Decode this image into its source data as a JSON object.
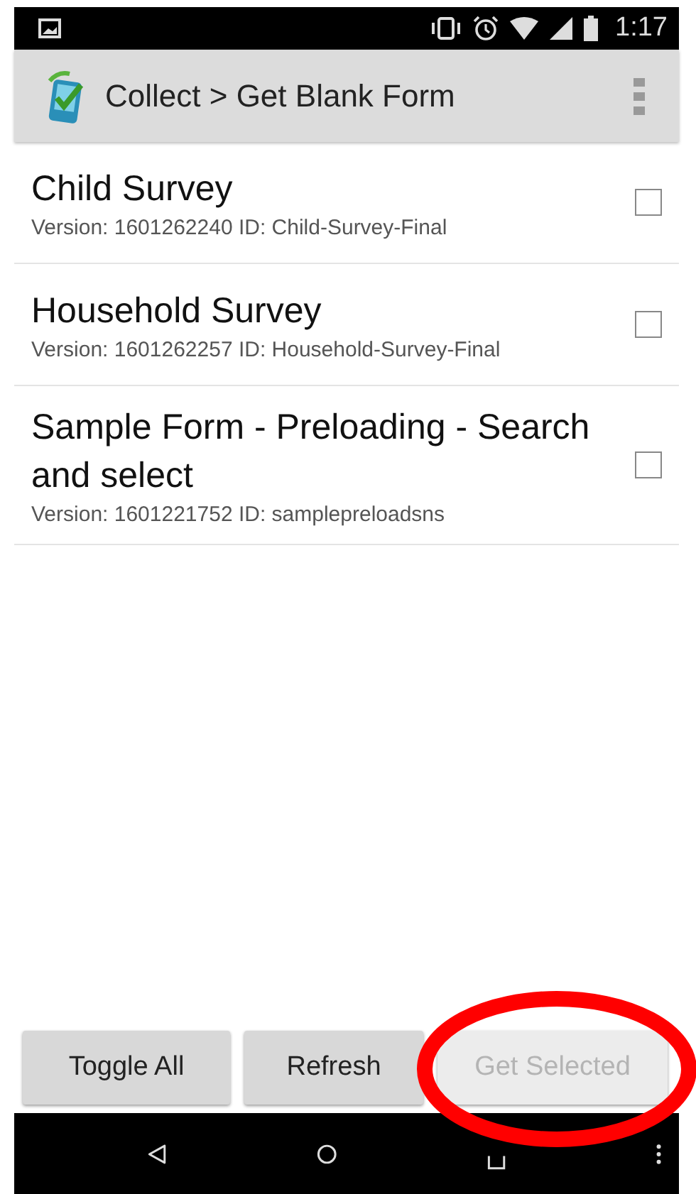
{
  "status_bar": {
    "time": "1:17"
  },
  "app_bar": {
    "title": "Collect > Get Blank Form"
  },
  "forms": [
    {
      "title": "Child Survey",
      "subtitle": "Version: 1601262240 ID: Child-Survey-Final",
      "checked": false
    },
    {
      "title": "Household Survey",
      "subtitle": "Version: 1601262257 ID: Household-Survey-Final",
      "checked": false
    },
    {
      "title": "Sample Form - Preloading - Search and select",
      "subtitle": "Version: 1601221752 ID: samplepreloadsns",
      "checked": false
    }
  ],
  "buttons": [
    {
      "label": "Toggle All",
      "disabled": false
    },
    {
      "label": "Refresh",
      "disabled": false
    },
    {
      "label": "Get Selected",
      "disabled": true
    }
  ],
  "annotation": {
    "kind": "ellipse",
    "color": "#ff0000"
  }
}
